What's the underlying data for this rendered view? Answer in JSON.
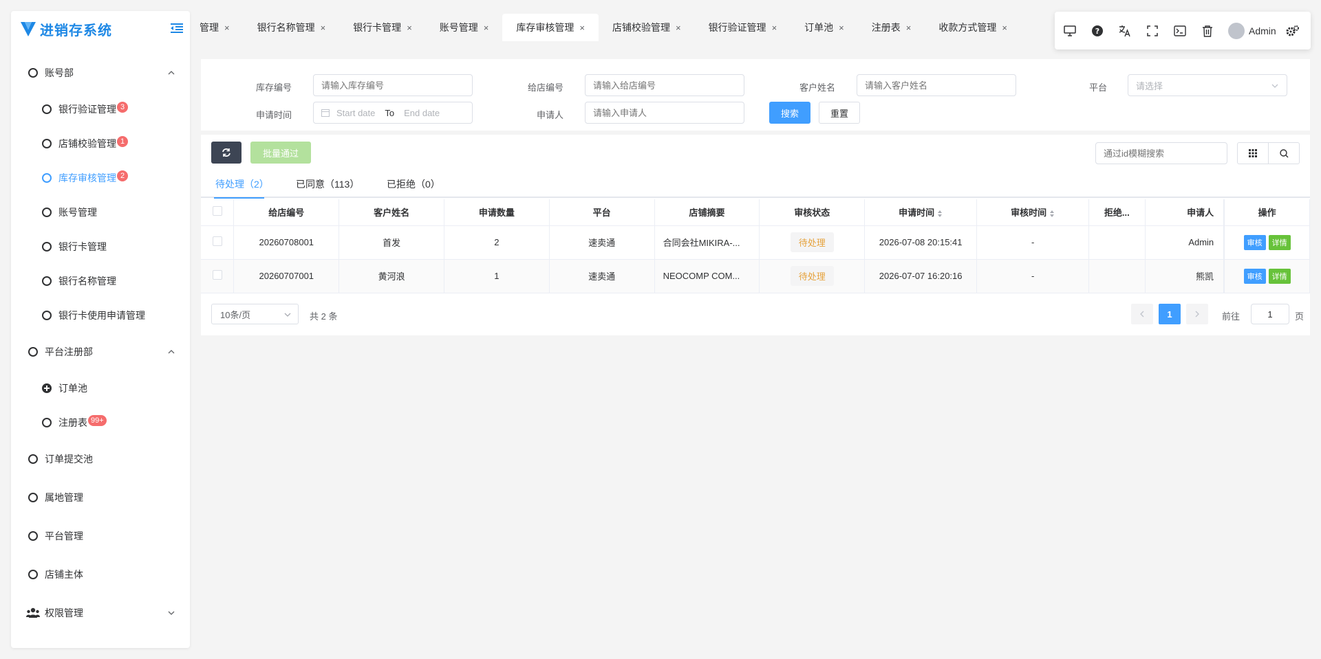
{
  "colors": {
    "primary": "#409eff",
    "logo": "#1e88e5",
    "badge": "#f56c6c",
    "pending": "#e6a23c",
    "success": "#67c23a",
    "dark_btn": "#3d4554"
  },
  "logo": {
    "text": "进销存系统"
  },
  "sidebar": {
    "items": [
      {
        "label": "账号部",
        "icon": "circle-icon",
        "expanded": true
      },
      {
        "label": "银行验证管理",
        "badge": "3"
      },
      {
        "label": "店铺校验管理",
        "badge": "1"
      },
      {
        "label": "库存审核管理",
        "badge": "2",
        "active": true
      },
      {
        "label": "账号管理"
      },
      {
        "label": "银行卡管理"
      },
      {
        "label": "银行名称管理"
      },
      {
        "label": "银行卡使用申请管理"
      },
      {
        "label": "平台注册部",
        "expanded": true
      },
      {
        "label": "订单池",
        "icon": "plus-circle-icon"
      },
      {
        "label": "注册表",
        "badge": "99+"
      },
      {
        "label": "订单提交池"
      },
      {
        "label": "属地管理"
      },
      {
        "label": "平台管理"
      },
      {
        "label": "店铺主体"
      },
      {
        "label": "权限管理",
        "icon": "users-icon",
        "expanded": false
      }
    ]
  },
  "tabs": [
    {
      "label": "管理"
    },
    {
      "label": "银行名称管理"
    },
    {
      "label": "银行卡管理"
    },
    {
      "label": "账号管理"
    },
    {
      "label": "库存审核管理",
      "active": true
    },
    {
      "label": "店铺校验管理"
    },
    {
      "label": "银行验证管理"
    },
    {
      "label": "订单池"
    },
    {
      "label": "注册表"
    },
    {
      "label": "收款方式管理"
    }
  ],
  "toolbar": {
    "user": "Admin",
    "icons": [
      "monitor-icon",
      "help-icon",
      "translate-icon",
      "fullscreen-icon",
      "terminal-icon",
      "trash-icon",
      "settings-icon"
    ]
  },
  "search": {
    "stock_no_label": "库存编号",
    "stock_no_placeholder": "请输入库存编号",
    "store_no_label": "给店编号",
    "store_no_placeholder": "请输入给店编号",
    "customer_label": "客户姓名",
    "customer_placeholder": "请输入客户姓名",
    "platform_label": "平台",
    "platform_placeholder": "请选择",
    "time_label": "申请时间",
    "start_placeholder": "Start date",
    "to": "To",
    "end_placeholder": "End date",
    "applicant_label": "申请人",
    "applicant_placeholder": "请输入申请人",
    "search_button": "搜索",
    "reset_button": "重置"
  },
  "actions": {
    "batch_approve": "批量通过",
    "id_search_placeholder": "通过id模糊搜索"
  },
  "status_tabs": [
    {
      "label": "待处理（2）",
      "active": true
    },
    {
      "label": "已同意（113）"
    },
    {
      "label": "已拒绝（0）"
    }
  ],
  "table": {
    "columns": [
      "给店编号",
      "客户姓名",
      "申请数量",
      "平台",
      "店铺摘要",
      "审核状态",
      "申请时间",
      "审核时间",
      "拒绝...",
      "申请人",
      "操作"
    ],
    "rows": [
      {
        "store_no": "20260708001",
        "customer": "首发",
        "qty": "2",
        "platform": "速卖通",
        "summary": "合同会社MIKIRA-...",
        "status": "待处理",
        "apply_time": "2026-07-08 20:15:41",
        "review_time": "-",
        "reject": "",
        "applicant": "Admin",
        "review_btn": "审核",
        "detail_btn": "详情"
      },
      {
        "store_no": "20260707001",
        "customer": "黄河浪",
        "qty": "1",
        "platform": "速卖通",
        "summary": "NEOCOMP COM...",
        "status": "待处理",
        "apply_time": "2026-07-07 16:20:16",
        "review_time": "-",
        "reject": "",
        "applicant": "熊凯",
        "review_btn": "审核",
        "detail_btn": "详情"
      }
    ]
  },
  "pagination": {
    "page_size": "10条/页",
    "total": "共 2 条",
    "current_page": "1",
    "goto_label": "前往",
    "goto_value": "1",
    "page_unit": "页"
  }
}
